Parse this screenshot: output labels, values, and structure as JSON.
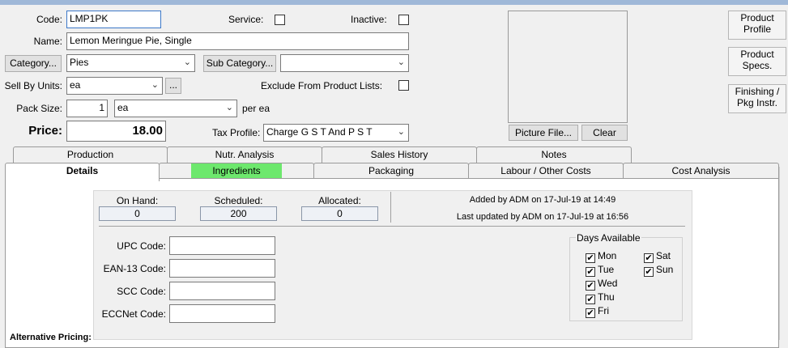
{
  "form": {
    "code_label": "Code:",
    "code_value": "LMP1PK",
    "service_label": "Service:",
    "inactive_label": "Inactive:",
    "name_label": "Name:",
    "name_value": "Lemon Meringue Pie, Single",
    "category_button": "Category...",
    "category_value": "Pies",
    "subcategory_button": "Sub Category...",
    "subcategory_value": "",
    "sell_by_units_label": "Sell By Units:",
    "sell_by_units_value": "ea",
    "ellipsis_button": "...",
    "exclude_label": "Exclude From Product Lists:",
    "pack_size_label": "Pack Size:",
    "pack_size_value": "1",
    "pack_unit_value": "ea",
    "per_unit_label": "per ea",
    "price_label": "Price:",
    "price_value": "18.00",
    "tax_profile_label": "Tax Profile:",
    "tax_profile_value": "Charge G S T And P S T"
  },
  "picture": {
    "picture_file_button": "Picture File...",
    "clear_button": "Clear"
  },
  "side_buttons": {
    "product_profile": [
      "Product",
      "Profile"
    ],
    "product_specs": [
      "Product",
      "Specs."
    ],
    "finishing": [
      "Finishing /",
      "Pkg Instr."
    ]
  },
  "tabs_back": [
    "Production",
    "Nutr. Analysis",
    "Sales History",
    "Notes"
  ],
  "tabs_front": [
    "Details",
    "Ingredients",
    "Packaging",
    "Labour / Other Costs",
    "Cost Analysis"
  ],
  "details": {
    "on_hand_label": "On Hand:",
    "on_hand_value": "0",
    "scheduled_label": "Scheduled:",
    "scheduled_value": "200",
    "allocated_label": "Allocated:",
    "allocated_value": "0",
    "added_by": "Added by ADM on 17-Jul-19 at 14:49",
    "last_updated": "Last updated by ADM on 17-Jul-19 at 16:56",
    "upc_label": "UPC Code:",
    "ean_label": "EAN-13 Code:",
    "scc_label": "SCC Code:",
    "eccnet_label": "ECCNet Code:",
    "days_title": "Days Available",
    "days": [
      "Mon",
      "Tue",
      "Wed",
      "Thu",
      "Fri",
      "Sat",
      "Sun"
    ],
    "check_mark": "✔",
    "alternative_pricing": "Alternative Pricing:"
  },
  "colors": {
    "ingredients_tab": "#6de86d",
    "window_bg": "#f0f0f0",
    "title_strip": "#9fb8d8"
  }
}
